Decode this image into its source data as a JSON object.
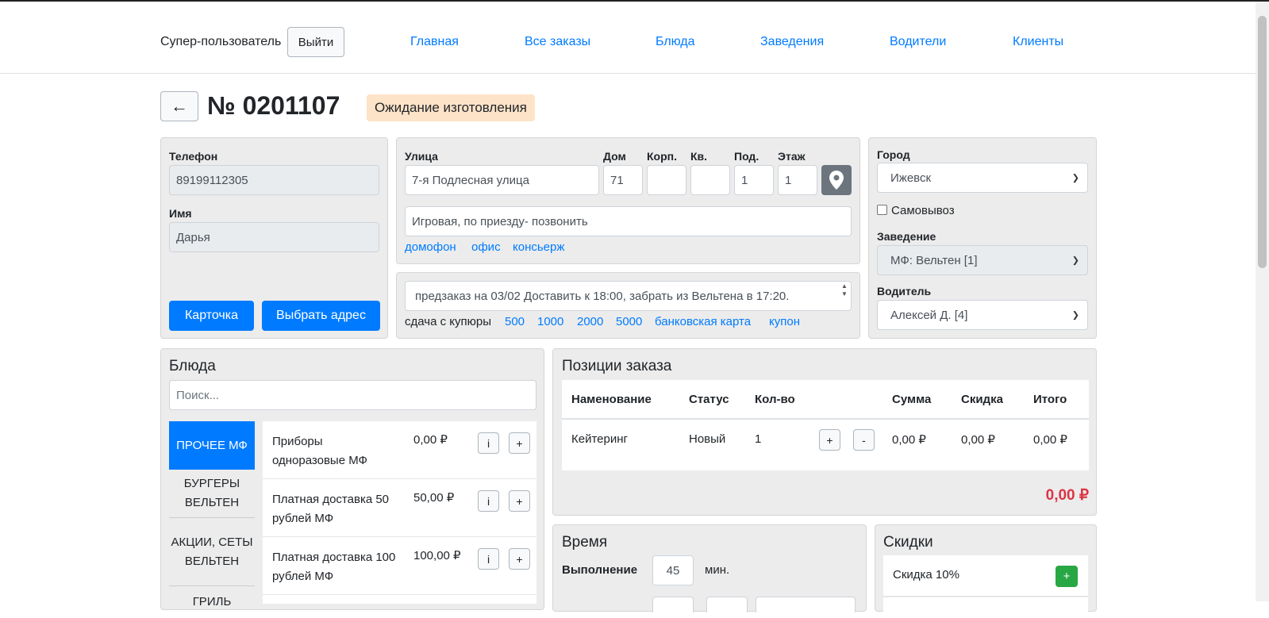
{
  "nav": {
    "user": "Супер-пользователь",
    "logout": "Выйти",
    "links": [
      "Главная",
      "Все заказы",
      "Блюда",
      "Заведения",
      "Водители",
      "Клиенты"
    ]
  },
  "order": {
    "back": "←",
    "number": "№ 0201107",
    "status": "Ожидание изготовления"
  },
  "client": {
    "phone_label": "Телефон",
    "phone": "89199112305",
    "name_label": "Имя",
    "name": "Дарья",
    "card_btn": "Карточка",
    "address_btn": "Выбрать адрес"
  },
  "address": {
    "street_label": "Улица",
    "street": "7-я Подлесная улица",
    "house_label": "Дом",
    "house": "71",
    "block_label": "Корп.",
    "block": "",
    "apt_label": "Кв.",
    "apt": "",
    "entrance_label": "Под.",
    "entrance": "1",
    "floor_label": "Этаж",
    "floor": "1",
    "comment": "Игровая, по приезду- позвонить",
    "quick": [
      "домофон",
      "офис",
      "консьерж"
    ],
    "note": "предзаказ на 03/02 Доставить к 18:00, забрать из Вельтена в 17:20.",
    "change_label": "сдача с купюры",
    "change": [
      "500",
      "1000",
      "2000",
      "5000",
      "банковская карта",
      "купон"
    ]
  },
  "side": {
    "city_label": "Город",
    "city": "Ижевск",
    "pickup": "Самовывоз",
    "place_label": "Заведение",
    "place": "МФ: Вельтен [1]",
    "driver_label": "Водитель",
    "driver": "Алексей Д. [4]"
  },
  "dishes": {
    "title": "Блюда",
    "search_placeholder": "Поиск...",
    "categories": [
      "ПРОЧЕЕ МФ",
      "БУРГЕРЫ ВЕЛЬТЕН",
      "АКЦИИ, СЕТЫ ВЕЛЬТЕН",
      "ГРИЛЬ"
    ],
    "items": [
      {
        "name": "Приборы одноразовые МФ",
        "price": "0,00 ₽",
        "info": "i",
        "add": "+"
      },
      {
        "name": "Платная доставка 50 рублей МФ",
        "price": "50,00 ₽",
        "info": "i",
        "add": "+"
      },
      {
        "name": "Платная доставка 100 рублей МФ",
        "price": "100,00 ₽",
        "info": "i",
        "add": "+"
      }
    ]
  },
  "positions": {
    "title": "Позиции заказа",
    "headers": [
      "Наменование",
      "Статус",
      "Кол-во",
      "",
      "Сумма",
      "Скидка",
      "Итого"
    ],
    "rows": [
      {
        "name": "Кейтеринг",
        "status": "Новый",
        "qty": "1",
        "plus": "+",
        "minus": "-",
        "sum": "0,00 ₽",
        "discount": "0,00 ₽",
        "total": "0,00 ₽"
      }
    ],
    "grand_total": "0,00 ₽",
    "total_color": "#dc3545"
  },
  "time": {
    "title": "Время",
    "exec_label": "Выполнение",
    "exec_value": "45",
    "unit": "мин."
  },
  "discounts": {
    "title": "Скидки",
    "items": [
      {
        "name": "Скидка 10%",
        "add": "+"
      }
    ]
  }
}
